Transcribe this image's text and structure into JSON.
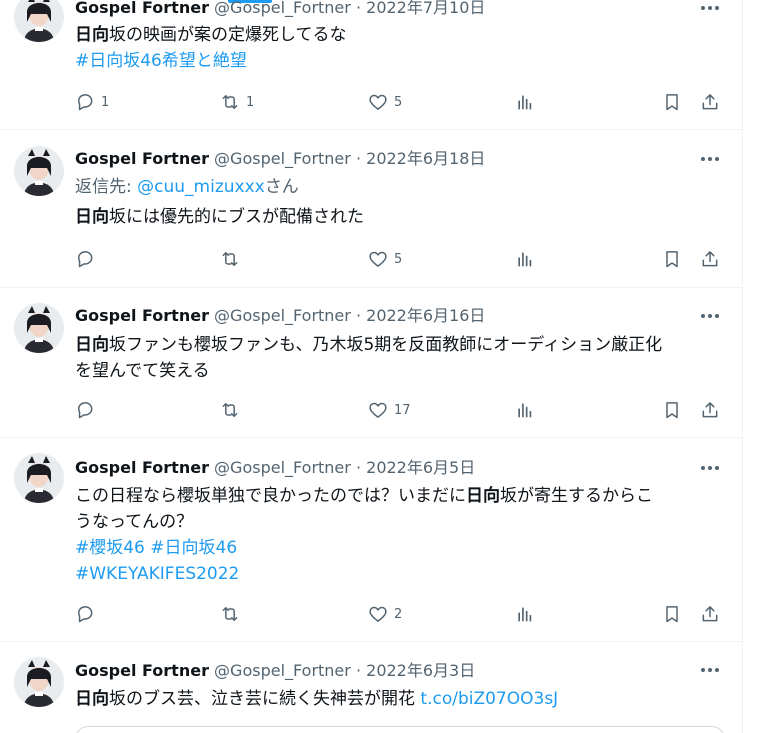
{
  "tweets": [
    {
      "name": "Gospel Fortner",
      "handle": "@Gospel_Fortner",
      "sep": "·",
      "date": "2022年7月10日",
      "text_bold": "日向",
      "text_rest": "坂の映画が案の定爆死してるな",
      "hashtags": "#日向坂46希望と絶望",
      "reply_count": "1",
      "retweet_count": "1",
      "like_count": "5"
    },
    {
      "name": "Gospel Fortner",
      "handle": "@Gospel_Fortner",
      "sep": "·",
      "date": "2022年6月18日",
      "reply_prefix": "返信先: ",
      "reply_to": "@cuu_mizuxxx",
      "reply_suffix": "さん",
      "text_bold": "日向",
      "text_rest": "坂には優先的にブスが配備された",
      "like_count": "5"
    },
    {
      "name": "Gospel Fortner",
      "handle": "@Gospel_Fortner",
      "sep": "·",
      "date": "2022年6月16日",
      "text_bold": "日向",
      "text_rest": "坂ファンも櫻坂ファンも、乃木坂5期を反面教師にオーディション厳正化",
      "text_line2": "を望んでて笑える",
      "like_count": "17"
    },
    {
      "name": "Gospel Fortner",
      "handle": "@Gospel_Fortner",
      "sep": "·",
      "date": "2022年6月5日",
      "text_pre": "この日程なら櫻坂単独で良かったのでは？いまだに",
      "text_bold": "日向",
      "text_post": "坂が寄生するからこ",
      "text_line2": "うなってんの？",
      "hashtags": "#櫻坂46 #日向坂46",
      "hashtags2": "#WKEYAKIFES2022",
      "like_count": "2"
    },
    {
      "name": "Gospel Fortner",
      "handle": "@Gospel_Fortner",
      "sep": "·",
      "date": "2022年6月3日",
      "text_bold": "日向",
      "text_rest": "坂のブス芸、泣き芸に続く失神芸が開花 ",
      "link": "t.co/biZ07OO3sJ"
    }
  ],
  "colors": {
    "accent": "#1d9bf0",
    "text": "#0f1419",
    "muted": "#536471",
    "divider": "#eff3f4"
  }
}
